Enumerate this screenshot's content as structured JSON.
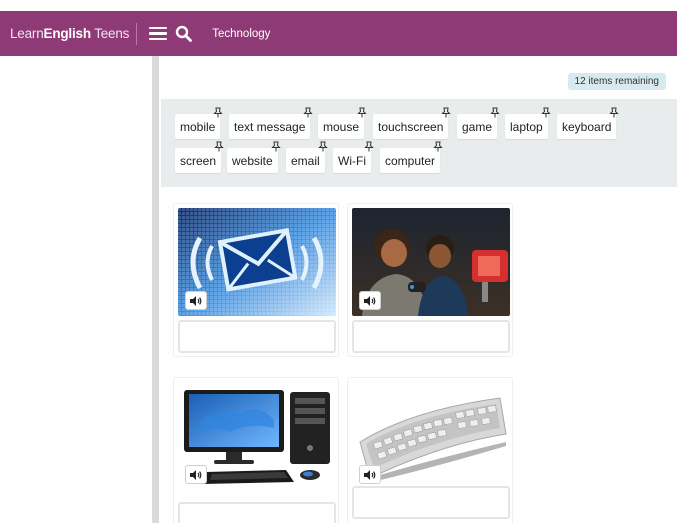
{
  "header": {
    "logo_light": "Learn",
    "logo_bold": "English",
    "logo_suffix": " Teens",
    "nav_title": "Technology",
    "accent": "#8e3a77"
  },
  "status": {
    "remaining": "12 items remaining"
  },
  "word_bank": [
    "mobile",
    "text message",
    "mouse",
    "touchscreen",
    "game",
    "laptop",
    "keyboard",
    "screen",
    "website",
    "email",
    "Wi-Fi",
    "computer"
  ],
  "cards": [
    {
      "image": "email-envelope-image",
      "answer": ""
    },
    {
      "image": "people-playing-game-image",
      "answer": ""
    },
    {
      "image": "desktop-computer-image",
      "answer": ""
    },
    {
      "image": "keyboard-image",
      "answer": ""
    }
  ],
  "icons": {
    "menu": "hamburger-menu-icon",
    "search": "search-icon",
    "pin": "pin-icon",
    "sound": "speaker-icon"
  }
}
